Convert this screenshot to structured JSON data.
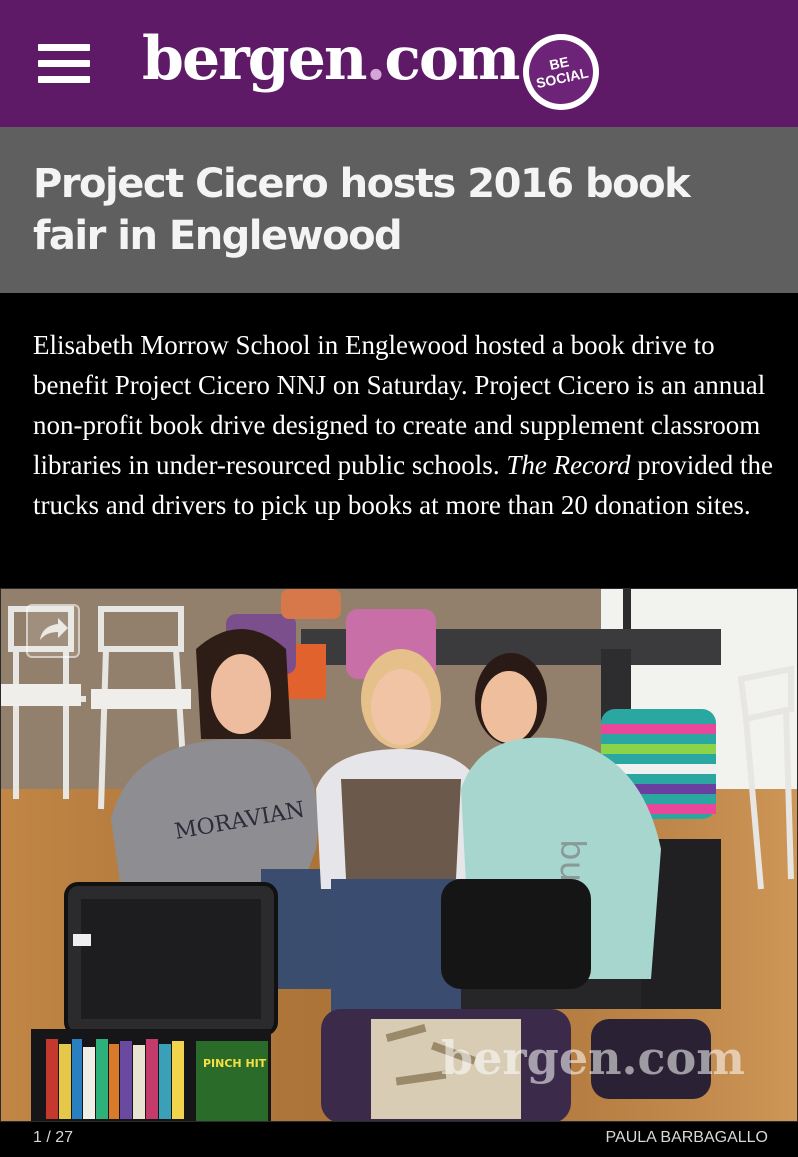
{
  "header": {
    "logo_text": "bergen",
    "logo_dot": ".",
    "logo_tld": "com",
    "badge_line1": "BE",
    "badge_line2": "SOCIAL",
    "brand_color": "#5e1a67"
  },
  "article": {
    "title": "Project Cicero hosts 2016 book fair in Englewood",
    "caption_part1": "Elisabeth Morrow School in Englewood hosted a book drive to benefit Project Cicero NNJ on Saturday. Project Cicero is an annual non-profit book drive designed to create and supplement classroom libraries in under-resourced public schools. ",
    "caption_italic": "The Record",
    "caption_part2": " provided the trucks and drivers to pick up books at more than 20 donation sites."
  },
  "gallery": {
    "counter": "1 / 27",
    "credit": "PAULA BARBAGALLO",
    "watermark": "bergen.com",
    "shirt_text": "burton",
    "sweatshirt_text": "MORAVIAN",
    "book_title": "PINCH HIT",
    "share_icon": "share-icon"
  }
}
